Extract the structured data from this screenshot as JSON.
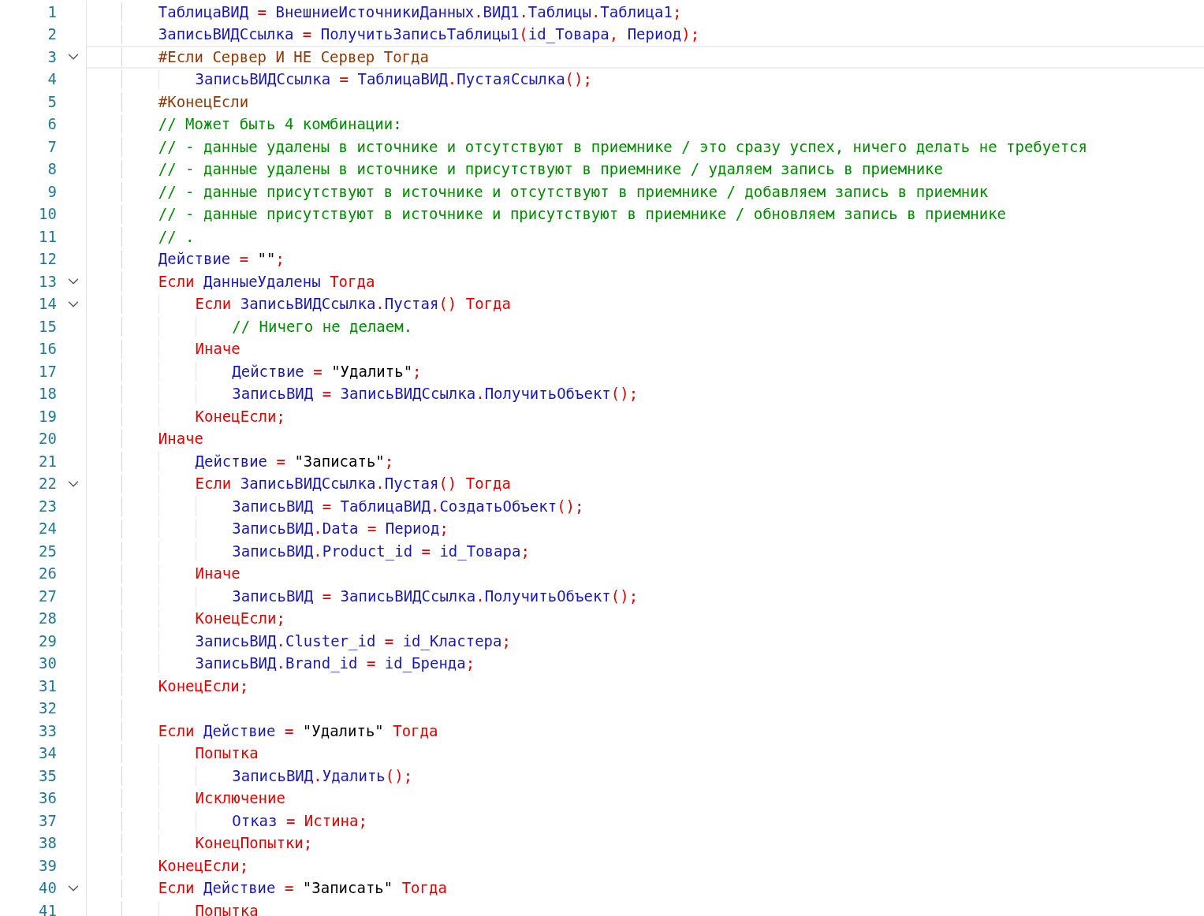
{
  "editor": {
    "lines": [
      {
        "number": "1",
        "foldable": false,
        "current": false,
        "tokens": [
          {
            "kind": "id",
            "text": "    ТаблицаВИД"
          },
          {
            "kind": "op",
            "text": " = "
          },
          {
            "kind": "id",
            "text": "ВнешниеИсточникиДанных"
          },
          {
            "kind": "op",
            "text": "."
          },
          {
            "kind": "id",
            "text": "ВИД1"
          },
          {
            "kind": "op",
            "text": "."
          },
          {
            "kind": "id",
            "text": "Таблицы"
          },
          {
            "kind": "op",
            "text": "."
          },
          {
            "kind": "id",
            "text": "Таблица1"
          },
          {
            "kind": "op",
            "text": ";"
          }
        ]
      },
      {
        "number": "2",
        "foldable": false,
        "current": false,
        "tokens": [
          {
            "kind": "id",
            "text": "    ЗаписьВИДСсылка"
          },
          {
            "kind": "op",
            "text": " = "
          },
          {
            "kind": "id",
            "text": "ПолучитьЗаписьТаблицы1"
          },
          {
            "kind": "op",
            "text": "("
          },
          {
            "kind": "id",
            "text": "id_Товара"
          },
          {
            "kind": "op",
            "text": ", "
          },
          {
            "kind": "id",
            "text": "Период"
          },
          {
            "kind": "op",
            "text": ");"
          }
        ]
      },
      {
        "number": "3",
        "foldable": true,
        "current": true,
        "tokens": [
          {
            "kind": "pre",
            "text": "    #Если Сервер И НЕ Сервер Тогда"
          }
        ]
      },
      {
        "number": "4",
        "foldable": false,
        "current": false,
        "tokens": [
          {
            "kind": "id",
            "text": "        ЗаписьВИДСсылка"
          },
          {
            "kind": "op",
            "text": " = "
          },
          {
            "kind": "id",
            "text": "ТаблицаВИД"
          },
          {
            "kind": "op",
            "text": "."
          },
          {
            "kind": "id",
            "text": "ПустаяСсылка"
          },
          {
            "kind": "op",
            "text": "();"
          }
        ]
      },
      {
        "number": "5",
        "foldable": false,
        "current": false,
        "tokens": [
          {
            "kind": "pre",
            "text": "    #КонецЕсли"
          }
        ]
      },
      {
        "number": "6",
        "foldable": false,
        "current": false,
        "tokens": [
          {
            "kind": "comment",
            "text": "    // Может быть 4 комбинации:"
          }
        ]
      },
      {
        "number": "7",
        "foldable": false,
        "current": false,
        "tokens": [
          {
            "kind": "comment",
            "text": "    // - данные удалены в источнике и отсутствуют в приемнике / это сразу успех, ничего делать не требуется"
          }
        ]
      },
      {
        "number": "8",
        "foldable": false,
        "current": false,
        "tokens": [
          {
            "kind": "comment",
            "text": "    // - данные удалены в источнике и присутствуют в приемнике / удаляем запись в приемнике"
          }
        ]
      },
      {
        "number": "9",
        "foldable": false,
        "current": false,
        "tokens": [
          {
            "kind": "comment",
            "text": "    // - данные присутствуют в источнике и отсутствуют в приемнике / добавляем запись в приемник"
          }
        ]
      },
      {
        "number": "10",
        "foldable": false,
        "current": false,
        "tokens": [
          {
            "kind": "comment",
            "text": "    // - данные присутствуют в источнике и присутствуют в приемнике / обновляем запись в приемнике"
          }
        ]
      },
      {
        "number": "11",
        "foldable": false,
        "current": false,
        "tokens": [
          {
            "kind": "comment",
            "text": "    // ."
          }
        ]
      },
      {
        "number": "12",
        "foldable": false,
        "current": false,
        "tokens": [
          {
            "kind": "id",
            "text": "    Действие"
          },
          {
            "kind": "op",
            "text": " = "
          },
          {
            "kind": "str",
            "text": "\"\""
          },
          {
            "kind": "op",
            "text": ";"
          }
        ]
      },
      {
        "number": "13",
        "foldable": true,
        "current": false,
        "tokens": [
          {
            "kind": "kw",
            "text": "    Если "
          },
          {
            "kind": "id",
            "text": "ДанныеУдалены"
          },
          {
            "kind": "kw",
            "text": " Тогда"
          }
        ]
      },
      {
        "number": "14",
        "foldable": true,
        "current": false,
        "tokens": [
          {
            "kind": "kw",
            "text": "        Если "
          },
          {
            "kind": "id",
            "text": "ЗаписьВИДСсылка"
          },
          {
            "kind": "op",
            "text": "."
          },
          {
            "kind": "id",
            "text": "Пустая"
          },
          {
            "kind": "op",
            "text": "() "
          },
          {
            "kind": "kw",
            "text": "Тогда"
          }
        ]
      },
      {
        "number": "15",
        "foldable": false,
        "current": false,
        "tokens": [
          {
            "kind": "comment",
            "text": "            // Ничего не делаем."
          }
        ]
      },
      {
        "number": "16",
        "foldable": false,
        "current": false,
        "tokens": [
          {
            "kind": "kw",
            "text": "        Иначе"
          }
        ]
      },
      {
        "number": "17",
        "foldable": false,
        "current": false,
        "tokens": [
          {
            "kind": "id",
            "text": "            Действие"
          },
          {
            "kind": "op",
            "text": " = "
          },
          {
            "kind": "str",
            "text": "\"Удалить\""
          },
          {
            "kind": "op",
            "text": ";"
          }
        ]
      },
      {
        "number": "18",
        "foldable": false,
        "current": false,
        "tokens": [
          {
            "kind": "id",
            "text": "            ЗаписьВИД"
          },
          {
            "kind": "op",
            "text": " = "
          },
          {
            "kind": "id",
            "text": "ЗаписьВИДСсылка"
          },
          {
            "kind": "op",
            "text": "."
          },
          {
            "kind": "id",
            "text": "ПолучитьОбъект"
          },
          {
            "kind": "op",
            "text": "();"
          }
        ]
      },
      {
        "number": "19",
        "foldable": false,
        "current": false,
        "tokens": [
          {
            "kind": "kw",
            "text": "        КонецЕсли;"
          }
        ]
      },
      {
        "number": "20",
        "foldable": false,
        "current": false,
        "tokens": [
          {
            "kind": "kw",
            "text": "    Иначе"
          }
        ]
      },
      {
        "number": "21",
        "foldable": false,
        "current": false,
        "tokens": [
          {
            "kind": "id",
            "text": "        Действие"
          },
          {
            "kind": "op",
            "text": " = "
          },
          {
            "kind": "str",
            "text": "\"Записать\""
          },
          {
            "kind": "op",
            "text": ";"
          }
        ]
      },
      {
        "number": "22",
        "foldable": true,
        "current": false,
        "tokens": [
          {
            "kind": "kw",
            "text": "        Если "
          },
          {
            "kind": "id",
            "text": "ЗаписьВИДСсылка"
          },
          {
            "kind": "op",
            "text": "."
          },
          {
            "kind": "id",
            "text": "Пустая"
          },
          {
            "kind": "op",
            "text": "() "
          },
          {
            "kind": "kw",
            "text": "Тогда"
          }
        ]
      },
      {
        "number": "23",
        "foldable": false,
        "current": false,
        "tokens": [
          {
            "kind": "id",
            "text": "            ЗаписьВИД"
          },
          {
            "kind": "op",
            "text": " = "
          },
          {
            "kind": "id",
            "text": "ТаблицаВИД"
          },
          {
            "kind": "op",
            "text": "."
          },
          {
            "kind": "id",
            "text": "СоздатьОбъект"
          },
          {
            "kind": "op",
            "text": "();"
          }
        ]
      },
      {
        "number": "24",
        "foldable": false,
        "current": false,
        "tokens": [
          {
            "kind": "id",
            "text": "            ЗаписьВИД"
          },
          {
            "kind": "op",
            "text": "."
          },
          {
            "kind": "id",
            "text": "Data"
          },
          {
            "kind": "op",
            "text": " = "
          },
          {
            "kind": "id",
            "text": "Период"
          },
          {
            "kind": "op",
            "text": ";"
          }
        ]
      },
      {
        "number": "25",
        "foldable": false,
        "current": false,
        "tokens": [
          {
            "kind": "id",
            "text": "            ЗаписьВИД"
          },
          {
            "kind": "op",
            "text": "."
          },
          {
            "kind": "id",
            "text": "Product_id"
          },
          {
            "kind": "op",
            "text": " = "
          },
          {
            "kind": "id",
            "text": "id_Товара"
          },
          {
            "kind": "op",
            "text": ";"
          }
        ]
      },
      {
        "number": "26",
        "foldable": false,
        "current": false,
        "tokens": [
          {
            "kind": "kw",
            "text": "        Иначе"
          }
        ]
      },
      {
        "number": "27",
        "foldable": false,
        "current": false,
        "tokens": [
          {
            "kind": "id",
            "text": "            ЗаписьВИД"
          },
          {
            "kind": "op",
            "text": " = "
          },
          {
            "kind": "id",
            "text": "ЗаписьВИДСсылка"
          },
          {
            "kind": "op",
            "text": "."
          },
          {
            "kind": "id",
            "text": "ПолучитьОбъект"
          },
          {
            "kind": "op",
            "text": "();"
          }
        ]
      },
      {
        "number": "28",
        "foldable": false,
        "current": false,
        "tokens": [
          {
            "kind": "kw",
            "text": "        КонецЕсли;"
          }
        ]
      },
      {
        "number": "29",
        "foldable": false,
        "current": false,
        "tokens": [
          {
            "kind": "id",
            "text": "        ЗаписьВИД"
          },
          {
            "kind": "op",
            "text": "."
          },
          {
            "kind": "id",
            "text": "Cluster_id"
          },
          {
            "kind": "op",
            "text": " = "
          },
          {
            "kind": "id",
            "text": "id_Кластера"
          },
          {
            "kind": "op",
            "text": ";"
          }
        ]
      },
      {
        "number": "30",
        "foldable": false,
        "current": false,
        "tokens": [
          {
            "kind": "id",
            "text": "        ЗаписьВИД"
          },
          {
            "kind": "op",
            "text": "."
          },
          {
            "kind": "id",
            "text": "Brand_id"
          },
          {
            "kind": "op",
            "text": " = "
          },
          {
            "kind": "id",
            "text": "id_Бренда"
          },
          {
            "kind": "op",
            "text": ";"
          }
        ]
      },
      {
        "number": "31",
        "foldable": false,
        "current": false,
        "tokens": [
          {
            "kind": "kw",
            "text": "    КонецЕсли;"
          }
        ]
      },
      {
        "number": "32",
        "foldable": false,
        "current": false
      },
      {
        "number": "33",
        "foldable": false,
        "current": false,
        "tokens": [
          {
            "kind": "kw",
            "text": "    Если "
          },
          {
            "kind": "id",
            "text": "Действие"
          },
          {
            "kind": "op",
            "text": " = "
          },
          {
            "kind": "str",
            "text": "\"Удалить\""
          },
          {
            "kind": "kw",
            "text": " Тогда"
          }
        ]
      },
      {
        "number": "34",
        "foldable": false,
        "current": false,
        "tokens": [
          {
            "kind": "kw",
            "text": "        Попытка"
          }
        ]
      },
      {
        "number": "35",
        "foldable": false,
        "current": false,
        "tokens": [
          {
            "kind": "id",
            "text": "            ЗаписьВИД"
          },
          {
            "kind": "op",
            "text": "."
          },
          {
            "kind": "id",
            "text": "Удалить"
          },
          {
            "kind": "op",
            "text": "();"
          }
        ]
      },
      {
        "number": "36",
        "foldable": false,
        "current": false,
        "tokens": [
          {
            "kind": "kw",
            "text": "        Исключение"
          }
        ]
      },
      {
        "number": "37",
        "foldable": false,
        "current": false,
        "tokens": [
          {
            "kind": "id",
            "text": "            Отказ"
          },
          {
            "kind": "op",
            "text": " = "
          },
          {
            "kind": "kw",
            "text": "Истина;"
          }
        ]
      },
      {
        "number": "38",
        "foldable": false,
        "current": false,
        "tokens": [
          {
            "kind": "kw",
            "text": "        КонецПопытки;"
          }
        ]
      },
      {
        "number": "39",
        "foldable": false,
        "current": false,
        "tokens": [
          {
            "kind": "kw",
            "text": "    КонецЕсли;"
          }
        ]
      },
      {
        "number": "40",
        "foldable": true,
        "current": false,
        "tokens": [
          {
            "kind": "kw",
            "text": "    Если "
          },
          {
            "kind": "id",
            "text": "Действие"
          },
          {
            "kind": "op",
            "text": " = "
          },
          {
            "kind": "str",
            "text": "\"Записать\""
          },
          {
            "kind": "kw",
            "text": " Тогда"
          }
        ]
      },
      {
        "number": "41",
        "foldable": false,
        "current": false,
        "tokens": [
          {
            "kind": "kw",
            "text": "        Попытка"
          }
        ]
      }
    ]
  }
}
